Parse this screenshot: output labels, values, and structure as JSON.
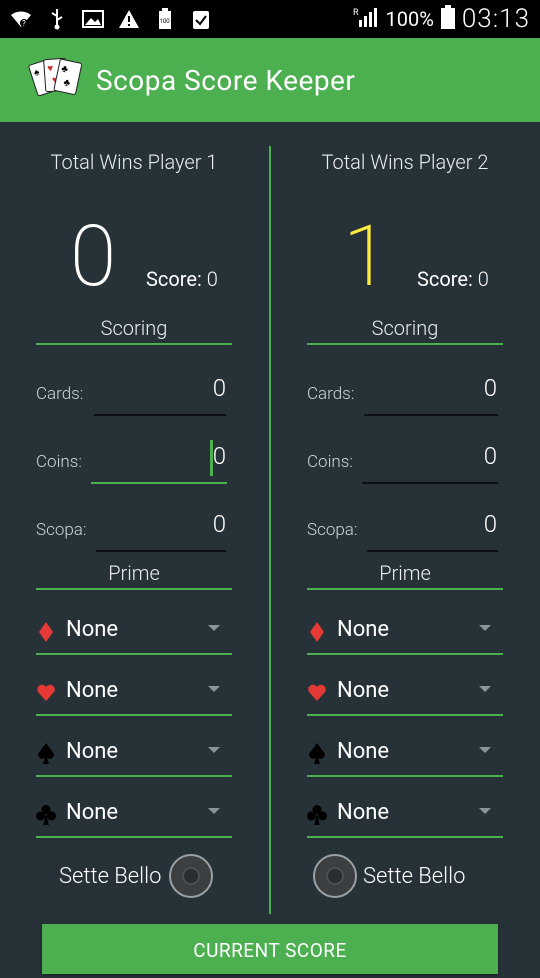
{
  "status_bar": {
    "battery": "100%",
    "time": "03:13",
    "icons": [
      "wifi-icon",
      "usb-icon",
      "image-icon",
      "warning-icon",
      "battery-100-icon",
      "clipboard-icon",
      "signal-icon",
      "battery-icon"
    ]
  },
  "app": {
    "title": "Scopa Score Keeper"
  },
  "players": [
    {
      "wins_title": "Total Wins Player 1",
      "wins": "0",
      "wins_color": "#ffffff",
      "score_label": "Score:",
      "score_value": "0",
      "scoring_header": "Scoring",
      "fields": {
        "cards_label": "Cards:",
        "cards_value": "0",
        "coins_label": "Coins:",
        "coins_value": "0",
        "scopa_label": "Scopa:",
        "scopa_value": "0"
      },
      "prime_header": "Prime",
      "prime": {
        "diamonds": "None",
        "hearts": "None",
        "spades": "None",
        "clubs": "None"
      },
      "sette_bello_label": "Sette Bello"
    },
    {
      "wins_title": "Total Wins Player 2",
      "wins": "1",
      "wins_color": "#ffeb3b",
      "score_label": "Score:",
      "score_value": "0",
      "scoring_header": "Scoring",
      "fields": {
        "cards_label": "Cards:",
        "cards_value": "0",
        "coins_label": "Coins:",
        "coins_value": "0",
        "scopa_label": "Scopa:",
        "scopa_value": "0"
      },
      "prime_header": "Prime",
      "prime": {
        "diamonds": "None",
        "hearts": "None",
        "spades": "None",
        "clubs": "None"
      },
      "sette_bello_label": "Sette Bello"
    }
  ],
  "buttons": {
    "current_score": "CURRENT SCORE"
  },
  "colors": {
    "accent": "#4CAF50",
    "background": "#263238",
    "suit_red": "#e53935"
  }
}
